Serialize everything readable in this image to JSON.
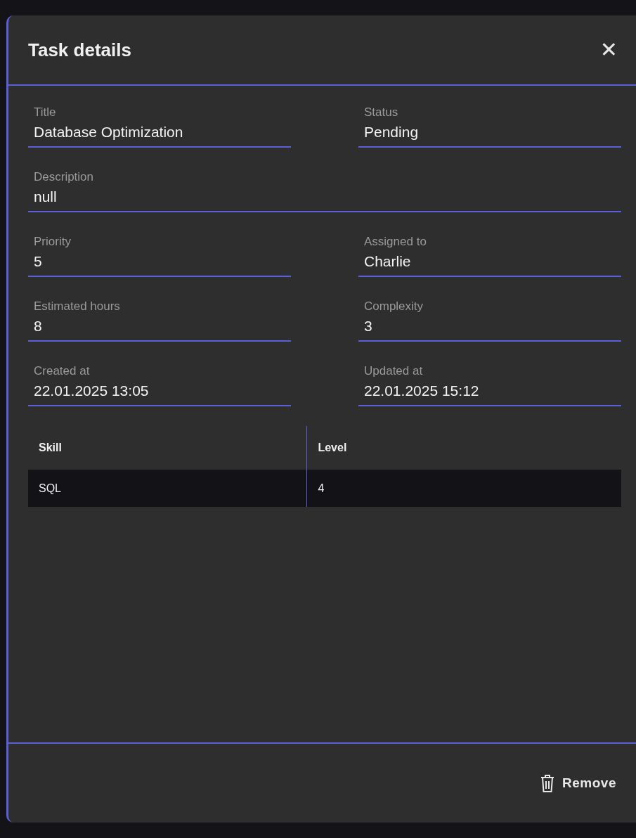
{
  "dialog": {
    "title": "Task details",
    "close": "✕"
  },
  "fields": [
    {
      "kind": "half",
      "label": "Title",
      "value": "Database Optimization"
    },
    {
      "kind": "half",
      "label": "Status",
      "value": "Pending"
    },
    {
      "kind": "wide",
      "label": "Description",
      "value": "null"
    },
    {
      "kind": "half",
      "label": "Priority",
      "value": "5"
    },
    {
      "kind": "half",
      "label": "Assigned to",
      "value": "Charlie"
    },
    {
      "kind": "half",
      "label": "Estimated hours",
      "value": "8"
    },
    {
      "kind": "half",
      "label": "Complexity",
      "value": "3"
    },
    {
      "kind": "half",
      "label": "Created at",
      "value": "22.01.2025 13:05"
    },
    {
      "kind": "half",
      "label": "Updated at",
      "value": "22.01.2025 15:12"
    }
  ],
  "table": {
    "columns": [
      "Skill",
      "Level"
    ],
    "rows": [
      [
        "SQL",
        "4"
      ]
    ]
  },
  "footer": {
    "remove_button": "Remove"
  }
}
